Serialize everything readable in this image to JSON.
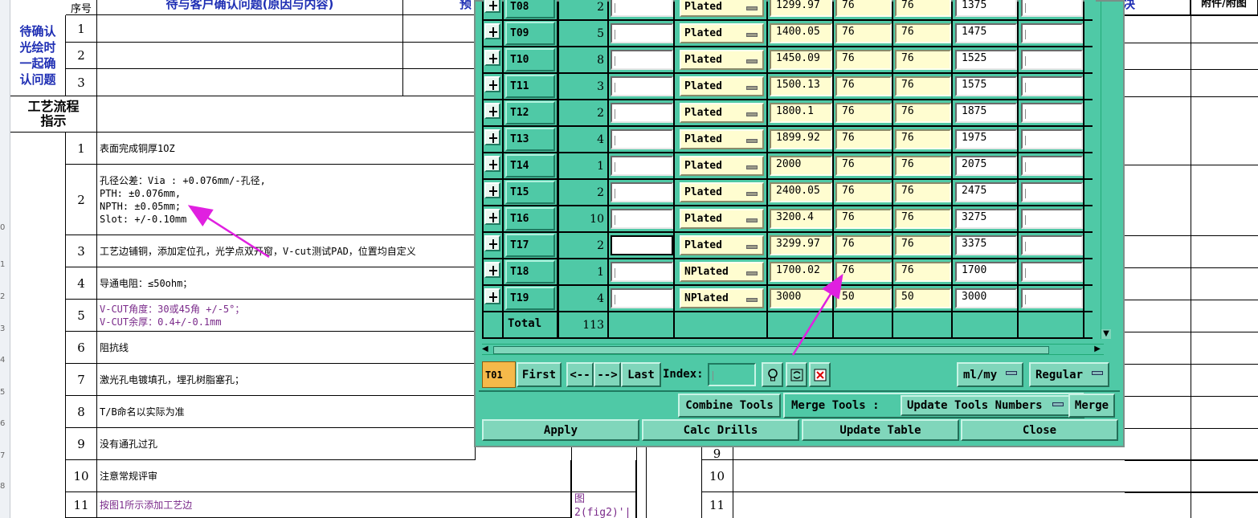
{
  "sheet": {
    "header": {
      "seq": "序号",
      "pending_title": "待与客户确认问题(原因与内容)",
      "pre_fragment": "预",
      "right_fragment": "决",
      "attach_title": "附件/附图"
    },
    "pending_label": "待确认光绘时一起确认问题",
    "pending_rows": [
      "1",
      "2",
      "3"
    ],
    "process_label": "工艺流程指示",
    "rows": [
      {
        "no": "1",
        "text": "表面完成铜厚1OZ",
        "purple": false
      },
      {
        "no": "2",
        "text": "孔径公差：Via : +0.076mm/-孔径,\nPTH: ±0.076mm,\nNPTH: ±0.05mm;\nSlot: +/-0.10mm",
        "purple": false
      },
      {
        "no": "3",
        "text": "工艺边铺铜，添加定位孔，光学点双开窗，V-cut测试PAD，位置均自定义",
        "purple": false
      },
      {
        "no": "4",
        "text": "导通电阻：≤50ohm；",
        "purple": false
      },
      {
        "no": "5",
        "text": "V-CUT角度：30或45角 +/-5°；\nV-CUT余厚：0.4+/-0.1mm",
        "purple": true
      },
      {
        "no": "6",
        "text": "阻抗线",
        "purple": false
      },
      {
        "no": "7",
        "text": "激光孔电镀填孔，埋孔树脂塞孔；",
        "purple": false
      },
      {
        "no": "8",
        "text": "T/B命名以实际为准",
        "purple": false
      },
      {
        "no": "9",
        "text": "没有通孔过孔",
        "purple": false
      },
      {
        "no": "10",
        "text": "注意常规评审",
        "purple": false
      },
      {
        "no": "11",
        "text": "按图1所示添加工艺边",
        "purple": true
      }
    ],
    "fig_ref": "图\n2(fig2)'|",
    "right_nums": [
      "9",
      "10",
      "11"
    ],
    "row_numbers": [
      "0",
      "1",
      "2",
      "3",
      "4",
      "5",
      "6",
      "7",
      "8"
    ]
  },
  "dialog": {
    "tools": [
      {
        "name": "T08",
        "count": "2",
        "type": "Plated",
        "size": "1299.97",
        "tol_plus": "76",
        "tol_minus": "76",
        "finish": "1375",
        "highlight": false
      },
      {
        "name": "T09",
        "count": "5",
        "type": "Plated",
        "size": "1400.05",
        "tol_plus": "76",
        "tol_minus": "76",
        "finish": "1475",
        "highlight": false
      },
      {
        "name": "T10",
        "count": "8",
        "type": "Plated",
        "size": "1450.09",
        "tol_plus": "76",
        "tol_minus": "76",
        "finish": "1525",
        "highlight": false
      },
      {
        "name": "T11",
        "count": "3",
        "type": "Plated",
        "size": "1500.13",
        "tol_plus": "76",
        "tol_minus": "76",
        "finish": "1575",
        "highlight": false
      },
      {
        "name": "T12",
        "count": "2",
        "type": "Plated",
        "size": "1800.1",
        "tol_plus": "76",
        "tol_minus": "76",
        "finish": "1875",
        "highlight": false
      },
      {
        "name": "T13",
        "count": "4",
        "type": "Plated",
        "size": "1899.92",
        "tol_plus": "76",
        "tol_minus": "76",
        "finish": "1975",
        "highlight": false
      },
      {
        "name": "T14",
        "count": "1",
        "type": "Plated",
        "size": "2000",
        "tol_plus": "76",
        "tol_minus": "76",
        "finish": "2075",
        "highlight": false
      },
      {
        "name": "T15",
        "count": "2",
        "type": "Plated",
        "size": "2400.05",
        "tol_plus": "76",
        "tol_minus": "76",
        "finish": "2475",
        "highlight": false
      },
      {
        "name": "T16",
        "count": "10",
        "type": "Plated",
        "size": "3200.4",
        "tol_plus": "76",
        "tol_minus": "76",
        "finish": "3275",
        "highlight": false
      },
      {
        "name": "T17",
        "count": "2",
        "type": "Plated",
        "size": "3299.97",
        "tol_plus": "76",
        "tol_minus": "76",
        "finish": "3375",
        "highlight": true
      },
      {
        "name": "T18",
        "count": "1",
        "type": "NPlated",
        "size": "1700.02",
        "tol_plus": "76",
        "tol_minus": "76",
        "finish": "1700",
        "highlight": false
      },
      {
        "name": "T19",
        "count": "4",
        "type": "NPlated",
        "size": "3000",
        "tol_plus": "50",
        "tol_minus": "50",
        "finish": "3000",
        "highlight": false
      }
    ],
    "total_label": "Total",
    "total_value": "113",
    "nav": {
      "current_tool": "T01",
      "first": "First",
      "prev": "<--",
      "next": "-->",
      "last": "Last",
      "index_label": "Index:",
      "index_value": "",
      "units": "ml/my",
      "mode": "Regular"
    },
    "actions": {
      "combine": "Combine Tools",
      "merge_label": "Merge Tools :",
      "merge_mode": "Update Tools Numbers",
      "merge": "Merge"
    },
    "bottom": {
      "apply": "Apply",
      "calc": "Calc Drills",
      "update": "Update Table",
      "close": "Close"
    },
    "colors": {
      "dialog_bg": "#4fc9a6",
      "field_yellow": "#fffdd0",
      "current_tool": "#f5b94a",
      "arrow": "#e020e0"
    }
  }
}
